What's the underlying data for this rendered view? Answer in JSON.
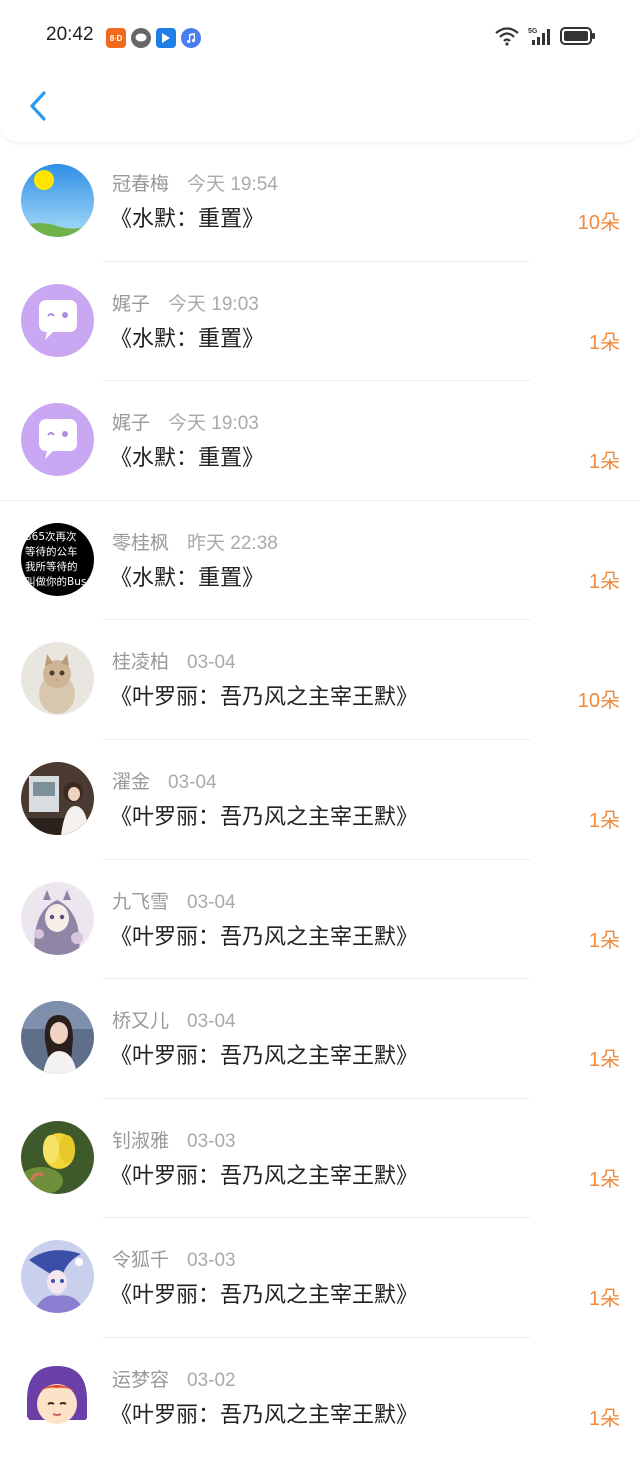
{
  "status_bar": {
    "time": "20:42",
    "notif_icon_a_text": "8∙D"
  },
  "rows": [
    {
      "name": "冠春梅",
      "time": "今天 19:54",
      "title": "《水默：重置》",
      "count": "10朵",
      "avatar": "sun-sky"
    },
    {
      "name": "娓子",
      "time": "今天 19:03",
      "title": "《水默：重置》",
      "count": "1朵",
      "avatar": "chat-bubble"
    },
    {
      "name": "娓子",
      "time": "今天 19:03",
      "title": "《水默：重置》",
      "count": "1朵",
      "avatar": "chat-bubble"
    },
    {
      "name": "零桂枫",
      "time": "昨天 22:38",
      "title": "《水默：重置》",
      "count": "1朵",
      "avatar": "text-black",
      "avatar_text": [
        "365次再次",
        "等待的公车",
        "我所等待的",
        "叫做你的Bus"
      ]
    },
    {
      "name": "桂凌柏",
      "time": "03-04",
      "title": "《叶罗丽：吾乃风之主宰王默》",
      "count": "10朵",
      "avatar": "kitten"
    },
    {
      "name": "濯金",
      "time": "03-04",
      "title": "《叶罗丽：吾乃风之主宰王默》",
      "count": "1朵",
      "avatar": "girl-room"
    },
    {
      "name": "九飞雪",
      "time": "03-04",
      "title": "《叶罗丽：吾乃风之主宰王默》",
      "count": "1朵",
      "avatar": "anime-lilac"
    },
    {
      "name": "桥又儿",
      "time": "03-04",
      "title": "《叶罗丽：吾乃风之主宰王默》",
      "count": "1朵",
      "avatar": "woman-portrait"
    },
    {
      "name": "钊淑雅",
      "time": "03-03",
      "title": "《叶罗丽：吾乃风之主宰王默》",
      "count": "1朵",
      "avatar": "yellow-flower"
    },
    {
      "name": "令狐千",
      "time": "03-03",
      "title": "《叶罗丽：吾乃风之主宰王默》",
      "count": "1朵",
      "avatar": "anime-blue"
    },
    {
      "name": "运梦容",
      "time": "03-02",
      "title": "《叶罗丽：吾乃风之主宰王默》",
      "count": "1朵",
      "avatar": "cartoon-face"
    }
  ],
  "colors": {
    "accent_back": "#2a9af0",
    "count": "#f08a3c",
    "name": "#999999",
    "title": "#222222"
  }
}
